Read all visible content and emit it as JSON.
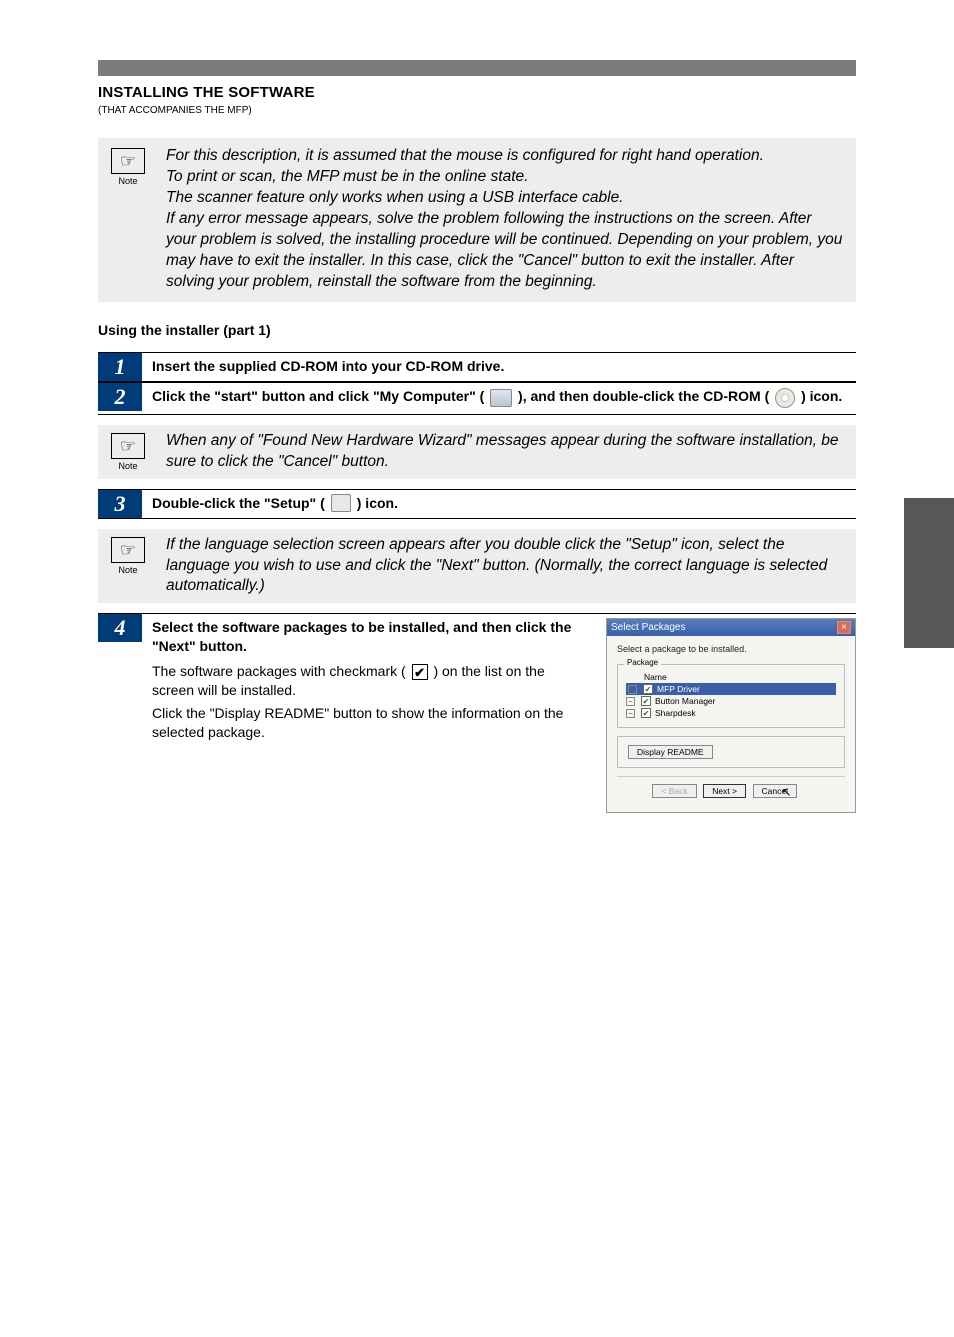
{
  "header": {
    "title": "INSTALLING THE SOFTWARE",
    "subtitle": "(THAT ACCOMPANIES THE MFP)"
  },
  "intro_note": "For this description, it is assumed that the mouse is configured for right hand operation.\nTo print or scan, the MFP must be in the online state.\nThe scanner feature only works when using a USB interface cable.\nIf any error message appears, solve the problem following the instructions on the screen. After your problem is solved, the installing procedure will be continued. Depending on your problem, you may have to exit the installer. In this case, click the \"Cancel\" button to exit the installer. After solving your problem, reinstall the software from the beginning.",
  "section_subtitle": "Using the installer (part 1)",
  "steps": {
    "s1": {
      "num": "1",
      "text": "Insert the supplied CD-ROM into your CD-ROM drive."
    },
    "s2": {
      "num": "2",
      "pre": "Click the \"start\" button and click \"My Computer\" (",
      "mid": "), and then double-click the CD-ROM (",
      "post": ") icon."
    },
    "note2": "When any of \"Found New Hardware Wizard\" messages appear during the software installation, be sure to click the \"Cancel\" button.",
    "s3": {
      "num": "3",
      "pre": "Double-click the \"Setup\" (",
      "post": ") icon."
    },
    "note3": "If the language selection screen appears after you double click the \"Setup\" icon, select the language you wish to use and click the \"Next\" button. (Normally, the correct language is selected automatically.)",
    "s4": {
      "num": "4",
      "line1": "Select the software packages to be installed, and then click the \"Next\" button.",
      "line2_pre": "The software packages with checkmark (",
      "line2_post": ") on the list on the screen will be installed.",
      "line3": "Click the \"Display README\" button to show the information on the selected package."
    }
  },
  "dialog": {
    "title": "Select Packages",
    "subtitle": "Select a package to be installed.",
    "pkg_legend": "Package",
    "items": {
      "name": "Name",
      "mfp": "MFP Driver",
      "btn": "Button Manager",
      "sharp": "Sharpdesk"
    },
    "readme": "Display README",
    "back": "< Back",
    "next": "Next >",
    "cancel": "Cancel"
  },
  "note_label": "Note"
}
